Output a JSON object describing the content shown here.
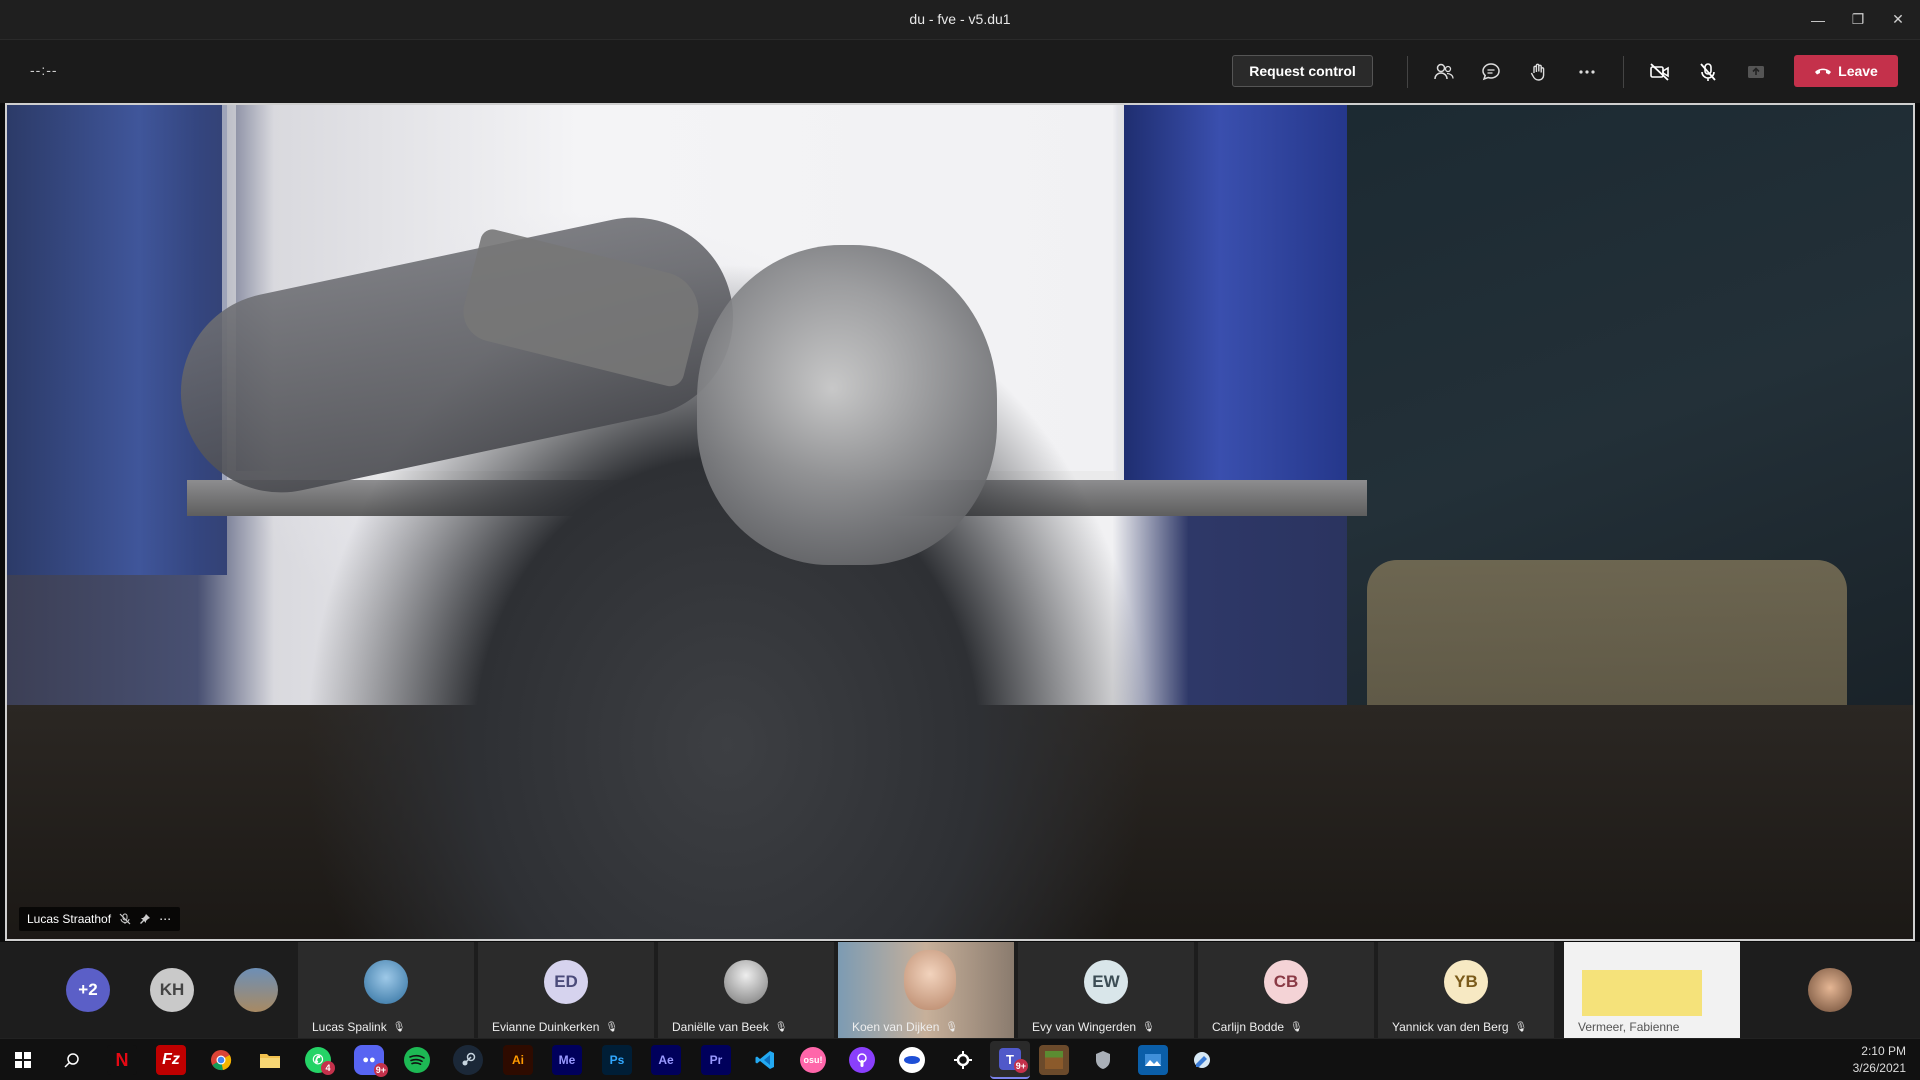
{
  "window": {
    "title": "du - fve - v5.du1"
  },
  "meeting": {
    "timer": "--:--",
    "request_control": "Request control",
    "leave_label": "Leave"
  },
  "main_video": {
    "participant_name": "Lucas Straathof"
  },
  "participants": [
    {
      "initials": "+2",
      "color": "#5b5fc7"
    },
    {
      "initials": "KH",
      "color": "#c9c9c9"
    },
    {
      "name": "Lucas Spalink"
    },
    {
      "name": "Evianne Duinkerken",
      "initials": "ED",
      "color": "#d6d3ee"
    },
    {
      "name": "Daniëlle van Beek"
    },
    {
      "name": "Koen van Dijken"
    },
    {
      "name": "Evy van Wingerden",
      "initials": "EW",
      "color": "#d9e6ea"
    },
    {
      "name": "Carlijn Bodde",
      "initials": "CB",
      "color": "#f4d3d6"
    },
    {
      "name": "Yannick van den Berg",
      "initials": "YB",
      "color": "#f7e9c3"
    },
    {
      "name": "Vermeer, Fabienne"
    }
  ],
  "taskbar": {
    "time": "2:10 PM",
    "date": "3/26/2021",
    "apps": [
      {
        "label": "Ai",
        "color": "#2e0b00",
        "text_color": "#ff9a00"
      },
      {
        "label": "Me",
        "color": "#00005b",
        "text_color": "#9999ff"
      },
      {
        "label": "Ps",
        "color": "#001e36",
        "text_color": "#31a8ff"
      },
      {
        "label": "Ae",
        "color": "#00005b",
        "text_color": "#9999ff"
      },
      {
        "label": "Pr",
        "color": "#00005b",
        "text_color": "#9999ff"
      }
    ],
    "badges": {
      "whatsapp": "4",
      "discord": "9+",
      "teams": "9+"
    },
    "osu_label": "osu!"
  },
  "colors": {
    "accent_leave": "#c4314b",
    "titlebar": "#1f1f1f",
    "strip": "#1d1d1d"
  }
}
